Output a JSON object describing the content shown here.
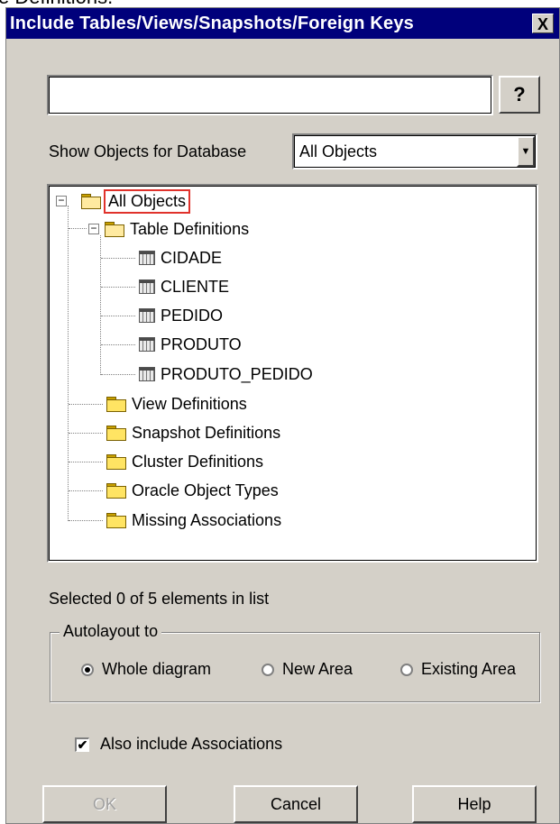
{
  "caption_fragment": "e Definitions.",
  "dialog": {
    "title": "Include Tables/Views/Snapshots/Foreign Keys",
    "close_label": "X"
  },
  "search": {
    "value": "",
    "placeholder": ""
  },
  "help_icon_glyph": "?",
  "database": {
    "label": "Show Objects for Database",
    "selected": "All Objects"
  },
  "tree": {
    "root": "All Objects",
    "table_definitions": "Table Definitions",
    "tables": [
      "CIDADE",
      "CLIENTE",
      "PEDIDO",
      "PRODUTO",
      "PRODUTO_PEDIDO"
    ],
    "folders": [
      "View Definitions",
      "Snapshot Definitions",
      "Cluster Definitions",
      "Oracle Object Types",
      "Missing Associations"
    ],
    "expander_open": "−"
  },
  "status": "Selected 0 of 5 elements in list",
  "autolayout": {
    "legend": "Autolayout to",
    "options": [
      "Whole diagram",
      "New Area",
      "Existing Area"
    ],
    "selected": "Whole diagram"
  },
  "associations": {
    "label": "Also include Associations",
    "checked": true,
    "check_glyph": "✔"
  },
  "buttons": {
    "ok": "OK",
    "cancel": "Cancel",
    "help": "Help"
  }
}
